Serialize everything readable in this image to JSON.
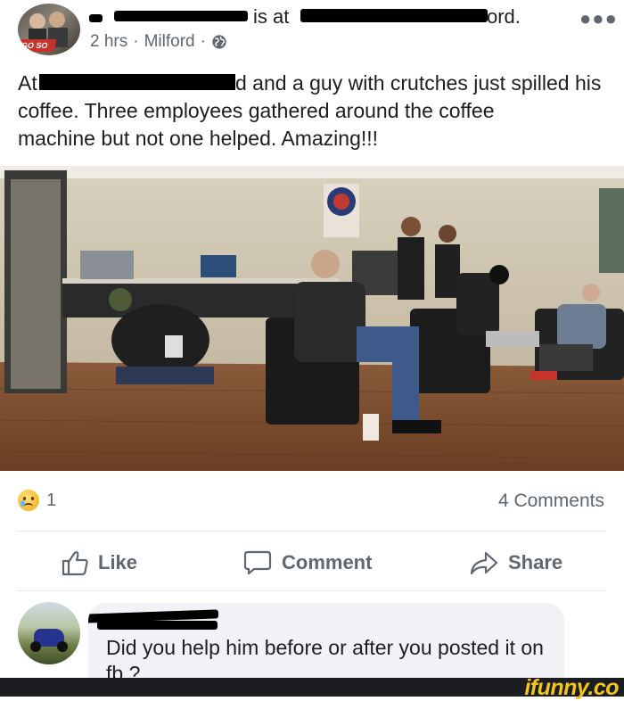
{
  "post": {
    "header_suffix_1": "is at",
    "header_suffix_2": "ord.",
    "avatar_badge": "GO SO",
    "time": "2 hrs",
    "separator_1": "·",
    "location": "Milford",
    "separator_2": "·",
    "text_line_1_prefix": "At",
    "text_line_1_suffix": "d and a guy with crutches just spilled his",
    "text_line_2": "coffee. Three employees gathered around the coffee",
    "text_line_3": "machine but not one helped. Amazing!!!",
    "reaction_count": "1",
    "comments_count": "4 Comments"
  },
  "actions": {
    "like": "Like",
    "comment": "Comment",
    "share": "Share"
  },
  "comment": {
    "text": "Did you help him before or after you posted it on fb  ?"
  },
  "watermark": "ifunny.co",
  "colors": {
    "text": "#1c1e21",
    "secondary_text": "#606770",
    "bubble": "#f0f2f5",
    "watermark": "#f4c51c"
  }
}
